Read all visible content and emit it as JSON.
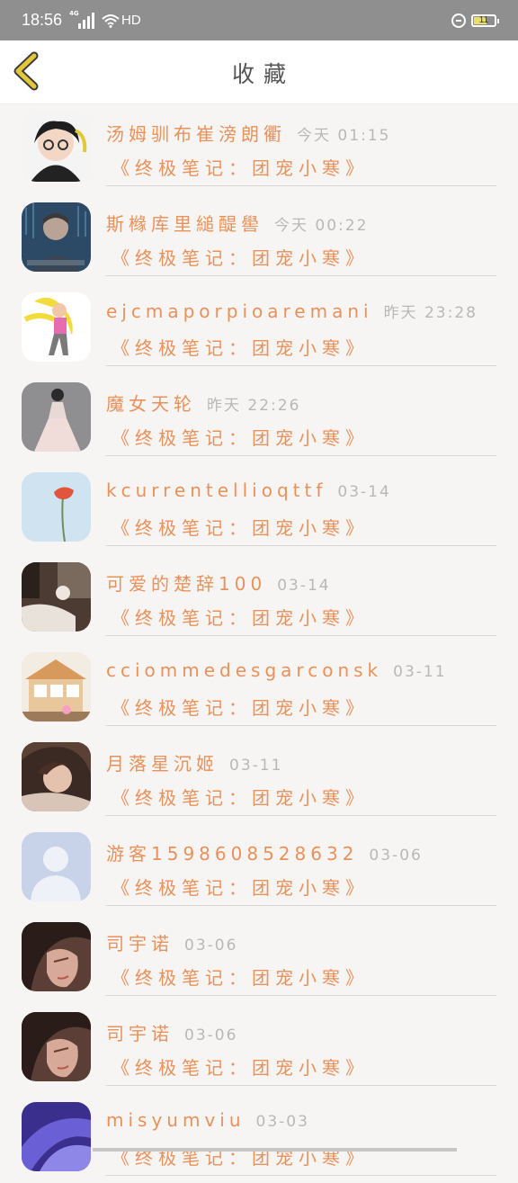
{
  "status_bar": {
    "time": "18:56",
    "network": "4G",
    "hd": "HD",
    "battery": "11",
    "battery_level": 0.11
  },
  "header": {
    "title": "收藏"
  },
  "colors": {
    "accent": "#e8925b",
    "time_gray": "#b8b8b8",
    "back_arrow": "#e3c73b"
  },
  "favorites": [
    {
      "user": "汤姆驯布崔滂朗衢",
      "time": "今天 01:15",
      "book": "《终极笔记：团宠小寒》",
      "avatar": "anime-boy-glasses"
    },
    {
      "user": "斯橼库里縋醍嚳",
      "time": "今天 00:22",
      "book": "《终极笔记：团宠小寒》",
      "avatar": "hacker-man"
    },
    {
      "user": "ejcmaporpioaremani",
      "time": "昨天 23:28",
      "book": "《终极笔记：团宠小寒》",
      "avatar": "cartoon-girl"
    },
    {
      "user": "魔女天轮",
      "time": "昨天 22:26",
      "book": "《终极笔记：团宠小寒》",
      "avatar": "girl-white-dress"
    },
    {
      "user": "kcurrentellioqttf",
      "time": "03-14",
      "book": "《终极笔记：团宠小寒》",
      "avatar": "red-flower"
    },
    {
      "user": "可爱的楚辞100",
      "time": "03-14",
      "book": "《终极笔记：团宠小寒》",
      "avatar": "room-photo"
    },
    {
      "user": "cciommedesgarconsk",
      "time": "03-11",
      "book": "《终极笔记：团宠小寒》",
      "avatar": "dollhouse"
    },
    {
      "user": "月落星沉姬",
      "time": "03-11",
      "book": "《终极笔记：团宠小寒》",
      "avatar": "lying-girl"
    },
    {
      "user": "游客1598608528632",
      "time": "03-06",
      "book": "《终极笔记：团宠小寒》",
      "avatar": "default-person"
    },
    {
      "user": "司宇诺",
      "time": "03-06",
      "book": "《终极笔记：团宠小寒》",
      "avatar": "dark-hair-face"
    },
    {
      "user": "司宇诺",
      "time": "03-06",
      "book": "《终极笔记：团宠小寒》",
      "avatar": "dark-hair-face"
    },
    {
      "user": "misyumviu",
      "time": "03-03",
      "book": "《终极笔记：团宠小寒》",
      "avatar": "purple-feathers"
    }
  ]
}
